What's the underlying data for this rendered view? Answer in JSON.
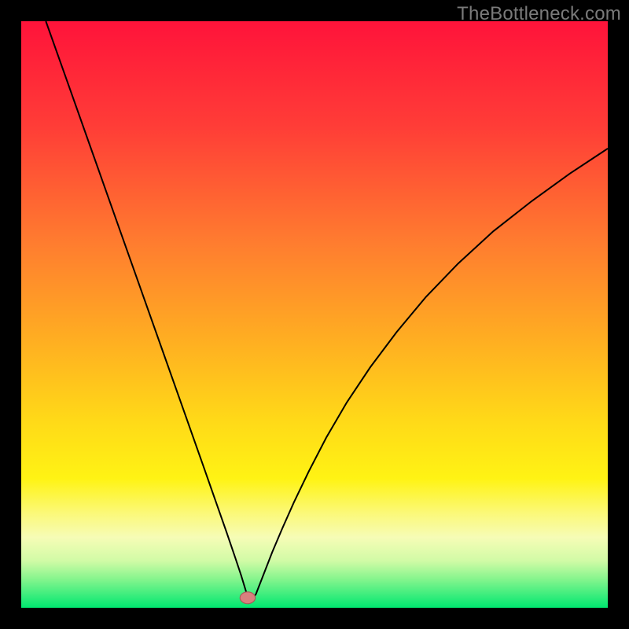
{
  "watermark": "TheBottleneck.com",
  "colors": {
    "page_bg": "#000000",
    "curve": "#000000",
    "marker_fill": "#d8807e",
    "marker_stroke": "#a85a58"
  },
  "chart_data": {
    "type": "line",
    "title": "",
    "xlabel": "",
    "ylabel": "",
    "xlim": [
      0,
      100
    ],
    "ylim": [
      0,
      100
    ],
    "grid": false,
    "gradient_stops": [
      {
        "offset": 0,
        "color": "#ff133a"
      },
      {
        "offset": 18,
        "color": "#ff3d37"
      },
      {
        "offset": 38,
        "color": "#ff7d2f"
      },
      {
        "offset": 55,
        "color": "#ffb021"
      },
      {
        "offset": 68,
        "color": "#ffd918"
      },
      {
        "offset": 78,
        "color": "#fff314"
      },
      {
        "offset": 84,
        "color": "#fbf97b"
      },
      {
        "offset": 88,
        "color": "#f6fcb6"
      },
      {
        "offset": 92,
        "color": "#d1fba6"
      },
      {
        "offset": 95,
        "color": "#88f58e"
      },
      {
        "offset": 100,
        "color": "#00e770"
      }
    ],
    "series": [
      {
        "name": "curve",
        "x": [
          4.2,
          8,
          12,
          16,
          20,
          24,
          28,
          31,
          33,
          35,
          36.5,
          37.5,
          38.2,
          38.9,
          40,
          41.4,
          42.8,
          44.5,
          46.5,
          49,
          52,
          55.5,
          59.5,
          64,
          69,
          74.5,
          80.5,
          87,
          93.5,
          100
        ],
        "y": [
          100,
          89.3,
          78,
          66.7,
          55.4,
          44.1,
          32.8,
          24.3,
          18.6,
          12.9,
          8.5,
          5.5,
          3.2,
          0.9,
          2.3,
          5.9,
          9.5,
          13.5,
          18,
          23.2,
          29,
          35,
          41,
          47,
          53,
          58.7,
          64.2,
          69.3,
          74,
          78.3
        ]
      }
    ],
    "marker": {
      "x": 38.6,
      "y": 1.7,
      "rx": 1.3,
      "ry": 1.0
    }
  }
}
